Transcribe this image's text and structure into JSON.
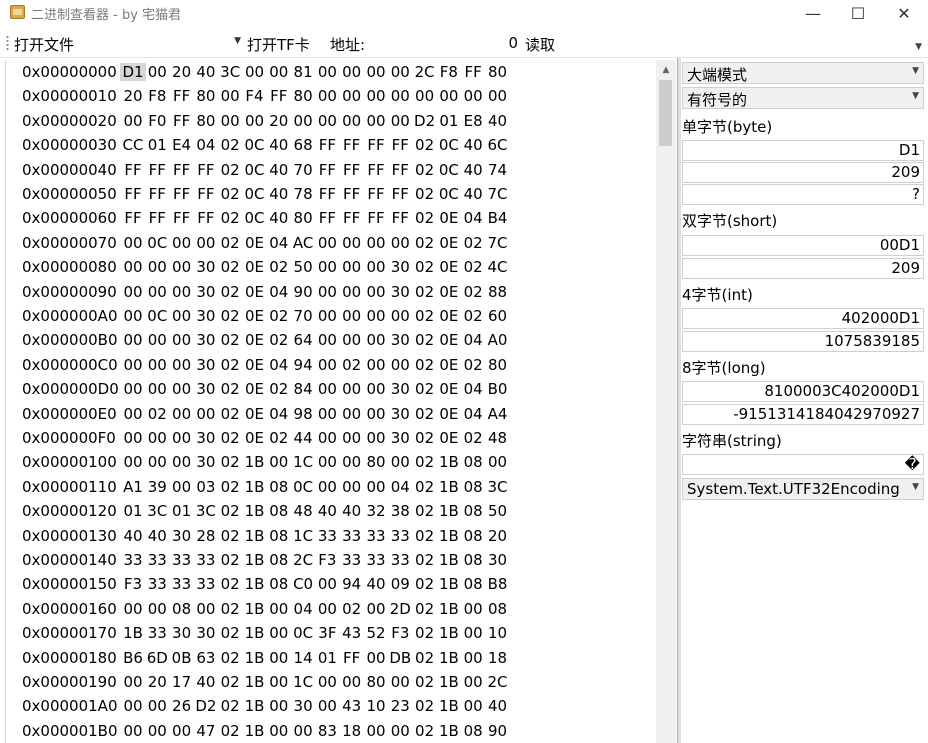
{
  "window": {
    "title": "二进制查看器 - by 宅猫君",
    "controls": {
      "minimize": "—",
      "maximize": "☐",
      "close": "✕"
    }
  },
  "toolbar": {
    "open_file": "打开文件",
    "open_tf": "打开TF卡",
    "address_label": "地址:",
    "address_value": "0",
    "read": "读取"
  },
  "hex": {
    "selected": {
      "row": 0,
      "col": 0
    },
    "rows": [
      {
        "addr": "0x00000000",
        "bytes": [
          "D1",
          "00",
          "20",
          "40",
          "3C",
          "00",
          "00",
          "81",
          "00",
          "00",
          "00",
          "00",
          "2C",
          "F8",
          "FF",
          "80"
        ]
      },
      {
        "addr": "0x00000010",
        "bytes": [
          "20",
          "F8",
          "FF",
          "80",
          "00",
          "F4",
          "FF",
          "80",
          "00",
          "00",
          "00",
          "00",
          "00",
          "00",
          "00",
          "00"
        ]
      },
      {
        "addr": "0x00000020",
        "bytes": [
          "00",
          "F0",
          "FF",
          "80",
          "00",
          "00",
          "20",
          "00",
          "00",
          "00",
          "00",
          "00",
          "D2",
          "01",
          "E8",
          "40"
        ]
      },
      {
        "addr": "0x00000030",
        "bytes": [
          "CC",
          "01",
          "E4",
          "04",
          "02",
          "0C",
          "40",
          "68",
          "FF",
          "FF",
          "FF",
          "FF",
          "02",
          "0C",
          "40",
          "6C"
        ]
      },
      {
        "addr": "0x00000040",
        "bytes": [
          "FF",
          "FF",
          "FF",
          "FF",
          "02",
          "0C",
          "40",
          "70",
          "FF",
          "FF",
          "FF",
          "FF",
          "02",
          "0C",
          "40",
          "74"
        ]
      },
      {
        "addr": "0x00000050",
        "bytes": [
          "FF",
          "FF",
          "FF",
          "FF",
          "02",
          "0C",
          "40",
          "78",
          "FF",
          "FF",
          "FF",
          "FF",
          "02",
          "0C",
          "40",
          "7C"
        ]
      },
      {
        "addr": "0x00000060",
        "bytes": [
          "FF",
          "FF",
          "FF",
          "FF",
          "02",
          "0C",
          "40",
          "80",
          "FF",
          "FF",
          "FF",
          "FF",
          "02",
          "0E",
          "04",
          "B4"
        ]
      },
      {
        "addr": "0x00000070",
        "bytes": [
          "00",
          "0C",
          "00",
          "00",
          "02",
          "0E",
          "04",
          "AC",
          "00",
          "00",
          "00",
          "00",
          "02",
          "0E",
          "02",
          "7C"
        ]
      },
      {
        "addr": "0x00000080",
        "bytes": [
          "00",
          "00",
          "00",
          "30",
          "02",
          "0E",
          "02",
          "50",
          "00",
          "00",
          "00",
          "30",
          "02",
          "0E",
          "02",
          "4C"
        ]
      },
      {
        "addr": "0x00000090",
        "bytes": [
          "00",
          "00",
          "00",
          "30",
          "02",
          "0E",
          "04",
          "90",
          "00",
          "00",
          "00",
          "30",
          "02",
          "0E",
          "02",
          "88"
        ]
      },
      {
        "addr": "0x000000A0",
        "bytes": [
          "00",
          "0C",
          "00",
          "30",
          "02",
          "0E",
          "02",
          "70",
          "00",
          "00",
          "00",
          "00",
          "02",
          "0E",
          "02",
          "60"
        ]
      },
      {
        "addr": "0x000000B0",
        "bytes": [
          "00",
          "00",
          "00",
          "30",
          "02",
          "0E",
          "02",
          "64",
          "00",
          "00",
          "00",
          "30",
          "02",
          "0E",
          "04",
          "A0"
        ]
      },
      {
        "addr": "0x000000C0",
        "bytes": [
          "00",
          "00",
          "00",
          "30",
          "02",
          "0E",
          "04",
          "94",
          "00",
          "02",
          "00",
          "00",
          "02",
          "0E",
          "02",
          "80"
        ]
      },
      {
        "addr": "0x000000D0",
        "bytes": [
          "00",
          "00",
          "00",
          "30",
          "02",
          "0E",
          "02",
          "84",
          "00",
          "00",
          "00",
          "30",
          "02",
          "0E",
          "04",
          "B0"
        ]
      },
      {
        "addr": "0x000000E0",
        "bytes": [
          "00",
          "02",
          "00",
          "00",
          "02",
          "0E",
          "04",
          "98",
          "00",
          "00",
          "00",
          "30",
          "02",
          "0E",
          "04",
          "A4"
        ]
      },
      {
        "addr": "0x000000F0",
        "bytes": [
          "00",
          "00",
          "00",
          "30",
          "02",
          "0E",
          "02",
          "44",
          "00",
          "00",
          "00",
          "30",
          "02",
          "0E",
          "02",
          "48"
        ]
      },
      {
        "addr": "0x00000100",
        "bytes": [
          "00",
          "00",
          "00",
          "30",
          "02",
          "1B",
          "00",
          "1C",
          "00",
          "00",
          "80",
          "00",
          "02",
          "1B",
          "08",
          "00"
        ]
      },
      {
        "addr": "0x00000110",
        "bytes": [
          "A1",
          "39",
          "00",
          "03",
          "02",
          "1B",
          "08",
          "0C",
          "00",
          "00",
          "00",
          "04",
          "02",
          "1B",
          "08",
          "3C"
        ]
      },
      {
        "addr": "0x00000120",
        "bytes": [
          "01",
          "3C",
          "01",
          "3C",
          "02",
          "1B",
          "08",
          "48",
          "40",
          "40",
          "32",
          "38",
          "02",
          "1B",
          "08",
          "50"
        ]
      },
      {
        "addr": "0x00000130",
        "bytes": [
          "40",
          "40",
          "30",
          "28",
          "02",
          "1B",
          "08",
          "1C",
          "33",
          "33",
          "33",
          "33",
          "02",
          "1B",
          "08",
          "20"
        ]
      },
      {
        "addr": "0x00000140",
        "bytes": [
          "33",
          "33",
          "33",
          "33",
          "02",
          "1B",
          "08",
          "2C",
          "F3",
          "33",
          "33",
          "33",
          "02",
          "1B",
          "08",
          "30"
        ]
      },
      {
        "addr": "0x00000150",
        "bytes": [
          "F3",
          "33",
          "33",
          "33",
          "02",
          "1B",
          "08",
          "C0",
          "00",
          "94",
          "40",
          "09",
          "02",
          "1B",
          "08",
          "B8"
        ]
      },
      {
        "addr": "0x00000160",
        "bytes": [
          "00",
          "00",
          "08",
          "00",
          "02",
          "1B",
          "00",
          "04",
          "00",
          "02",
          "00",
          "2D",
          "02",
          "1B",
          "00",
          "08"
        ]
      },
      {
        "addr": "0x00000170",
        "bytes": [
          "1B",
          "33",
          "30",
          "30",
          "02",
          "1B",
          "00",
          "0C",
          "3F",
          "43",
          "52",
          "F3",
          "02",
          "1B",
          "00",
          "10"
        ]
      },
      {
        "addr": "0x00000180",
        "bytes": [
          "B6",
          "6D",
          "0B",
          "63",
          "02",
          "1B",
          "00",
          "14",
          "01",
          "FF",
          "00",
          "DB",
          "02",
          "1B",
          "00",
          "18"
        ]
      },
      {
        "addr": "0x00000190",
        "bytes": [
          "00",
          "20",
          "17",
          "40",
          "02",
          "1B",
          "00",
          "1C",
          "00",
          "00",
          "80",
          "00",
          "02",
          "1B",
          "00",
          "2C"
        ]
      },
      {
        "addr": "0x000001A0",
        "bytes": [
          "00",
          "00",
          "26",
          "D2",
          "02",
          "1B",
          "00",
          "30",
          "00",
          "43",
          "10",
          "23",
          "02",
          "1B",
          "00",
          "40"
        ]
      },
      {
        "addr": "0x000001B0",
        "bytes": [
          "00",
          "00",
          "00",
          "47",
          "02",
          "1B",
          "00",
          "00",
          "83",
          "18",
          "00",
          "00",
          "02",
          "1B",
          "08",
          "90"
        ]
      }
    ]
  },
  "side": {
    "endian": "大端模式",
    "signed": "有符号的",
    "byte_label": "单字节(byte)",
    "byte_hex": "D1",
    "byte_dec": "209",
    "byte_char": "?",
    "short_label": "双字节(short)",
    "short_hex": "00D1",
    "short_dec": "209",
    "int_label": "4字节(int)",
    "int_hex": "402000D1",
    "int_dec": "1075839185",
    "long_label": "8字节(long)",
    "long_hex": "8100003C402000D1",
    "long_dec": "-9151314184042970927",
    "string_label": "字符串(string)",
    "string_value": "�",
    "encoding": "System.Text.UTF32Encoding"
  }
}
